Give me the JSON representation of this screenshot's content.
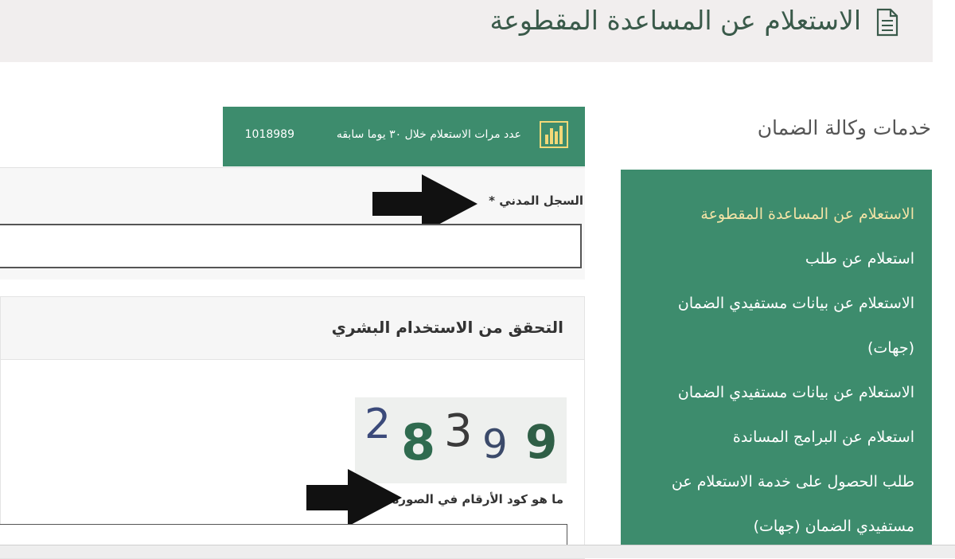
{
  "page": {
    "title": "الاستعلام عن المساعدة المقطوعة"
  },
  "services": {
    "title": "خدمات وكالة الضمان",
    "items": [
      {
        "label": "الاستعلام عن المساعدة المقطوعة",
        "active": true
      },
      {
        "label": "استعلام عن طلب"
      },
      {
        "label": "الاستعلام عن بيانات مستفيدي الضمان"
      },
      {
        "label": "(جهات)"
      },
      {
        "label": "الاستعلام عن بيانات مستفيدي الضمان"
      },
      {
        "label": "استعلام عن البرامج المساندة"
      },
      {
        "label": "طلب الحصول على خدمة الاستعلام عن"
      },
      {
        "label": "مستفيدي الضمان (جهات)"
      }
    ]
  },
  "stats": {
    "label": "عدد مرات الاستعلام خلال ٣٠ يوما سابقه",
    "value": "1018989",
    "icon": "bar-chart-icon"
  },
  "form": {
    "civil_record_label": "السجل المدني *",
    "civil_record_value": ""
  },
  "captcha": {
    "title": "التحقق من الاستخدام البشري",
    "chars": [
      "2",
      "8",
      "3",
      "9",
      "9"
    ],
    "question": "ما هو كود الأرقام في الصورة؟ *",
    "value": ""
  },
  "colors": {
    "accent": "#3d8c6d",
    "active_item": "#f3e3a6",
    "header_bg": "#f1eeee"
  }
}
